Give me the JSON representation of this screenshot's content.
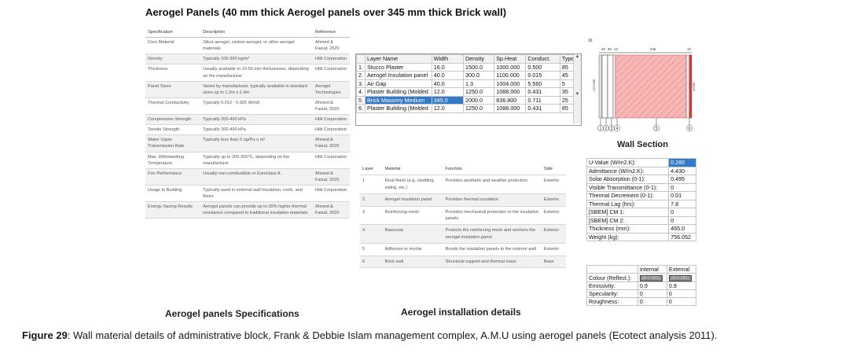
{
  "title": "Aerogel Panels (40 mm thick Aerogel panels over 345 mm thick Brick wall)",
  "specifications": {
    "headers": [
      "Specification",
      "Description",
      "Reference"
    ],
    "rows": [
      [
        "Core Material",
        "Silica aerogel, carbon aerogel, or other aerogel materials",
        "Ahmed & Faisal, 2020"
      ],
      [
        "Density",
        "Typically 100-300 kg/m³",
        "Hilti Corporation"
      ],
      [
        "Thickness",
        "Usually available in 10-50 mm thicknesses, depending on the manufacturer",
        "Hilti Corporation"
      ],
      [
        "Panel Sizes",
        "Varies by manufacturer, typically available in standard sizes up to 1.2m x 2.4m",
        "Aerogel Technologies"
      ],
      [
        "Thermal Conductivity",
        "Typically 0.012 - 0.025 W/mK",
        "Ahmed & Faisal, 2020"
      ],
      [
        "Compressive Strength",
        "Typically 200-400 kPa",
        "Hilti Corporation"
      ],
      [
        "Tensile Strength",
        "Typically 200-400 kPa",
        "Hilti Corporation"
      ],
      [
        "Water Vapor Transmission Rate",
        "Typically less than 5 ng/Pa·s·m²",
        "Ahmed & Faisal, 2020"
      ],
      [
        "Max. Withstanding Temperature",
        "Typically up to 200-300°C, depending on the manufacturer",
        "Hilti Corporation"
      ],
      [
        "Fire Performance",
        "Usually non-combustible or Euroclass A",
        "Ahmed & Faisal, 2020"
      ],
      [
        "Usage in Building",
        "Typically used in external wall insulation, roofs, and floors",
        "Hilti Corporation"
      ],
      [
        "Energy-Saving Results",
        "Aerogel panels can provide up to 30% higher thermal resistance compared to traditional insulation materials",
        "Ahmed & Faisal, 2020"
      ]
    ],
    "caption": "Aerogel panels Specifications"
  },
  "layers": {
    "headers": [
      "Layer Name",
      "Width",
      "Density",
      "Sp.Heat",
      "Conduct.",
      "Type"
    ],
    "rows": [
      [
        "1.",
        "Stucco Plaster",
        "16.0",
        "1500.0",
        "1000.000",
        "0.500",
        "85"
      ],
      [
        "2.",
        "Aerogel Insulation panel",
        "40.0",
        "300.0",
        "1100.000",
        "0.015",
        "45"
      ],
      [
        "3.",
        "Air Gap",
        "40.0",
        "1.3",
        "1004.000",
        "5.560",
        "5"
      ],
      [
        "4.",
        "Plaster Building (Molded",
        "12.0",
        "1250.0",
        "1088.000",
        "0.431",
        "35"
      ],
      [
        "5.",
        "Brick Masonry Medium",
        "345.0",
        "2000.0",
        "836.800",
        "0.711",
        "25"
      ],
      [
        "6.",
        "Plaster Building (Molded",
        "12.0",
        "1250.0",
        "1088.000",
        "0.431",
        "85"
      ]
    ],
    "selected_row": 4
  },
  "wall_section": {
    "caption": "Wall Section",
    "dims": [
      "16",
      "40",
      "40",
      "12",
      "346",
      "12"
    ],
    "markers": [
      "1",
      "2",
      "3",
      "4",
      "5",
      "6"
    ],
    "side_labels": [
      "OUTSIDE",
      "INSIDE"
    ]
  },
  "installation": {
    "headers": [
      "Layer",
      "Material",
      "Function",
      "Side"
    ],
    "rows": [
      [
        "1",
        "Final finish (e.g. cladding, siding, etc.)",
        "Provides aesthetic and weather protection",
        "Exterior"
      ],
      [
        "2",
        "Aerogel insulation panel",
        "Provides thermal insulation",
        "Exterior"
      ],
      [
        "3",
        "Reinforcing mesh",
        "Provides mechanical protection to the insulation panels",
        "Exterior"
      ],
      [
        "4",
        "Basecoat",
        "Protects the reinforcing mesh and anchors the aerogel insulation panel",
        "Exterior"
      ],
      [
        "5",
        "Adhesive or mortar",
        "Bonds the insulation panels to the exterior wall",
        "Exterior"
      ],
      [
        "6",
        "Brick wall",
        "Structural support and thermal mass",
        "Base"
      ]
    ],
    "caption": "Aerogel installation details"
  },
  "properties": [
    [
      "U-Value (W/m2.K):",
      "0.280"
    ],
    [
      "Admittance (W/m2.K):",
      "4.430"
    ],
    [
      "Solar Absorption (0-1):",
      "0.495"
    ],
    [
      "Visible Transmittance (0-1):",
      "0"
    ],
    [
      "Thermal Decrement (0-1):",
      "0.01"
    ],
    [
      "Thermal Lag (hrs):",
      "7.8"
    ],
    [
      "[SBEM] CM 1:",
      "0"
    ],
    [
      "[SBEM] CM 2:",
      "0"
    ],
    [
      "Thickness (mm):",
      "465.0"
    ],
    [
      "Weight (kg):",
      "756.052"
    ]
  ],
  "surface": {
    "headers": [
      "",
      "Internal",
      "External"
    ],
    "rows": [
      [
        "Colour (Reflect.):",
        "(R:0.581)",
        "(R:0.581)"
      ],
      [
        "Emissivity:",
        "0.9",
        "0.9"
      ],
      [
        "Specularity:",
        "0",
        "0"
      ],
      [
        "Roughness:",
        "0",
        "0"
      ]
    ]
  },
  "figure_caption": {
    "label": "Figure 29",
    "text": ": Wall material details of administrative block, Frank & Debbie Islam management complex, A.M.U using aerogel panels (Ecotect analysis 2011)."
  }
}
